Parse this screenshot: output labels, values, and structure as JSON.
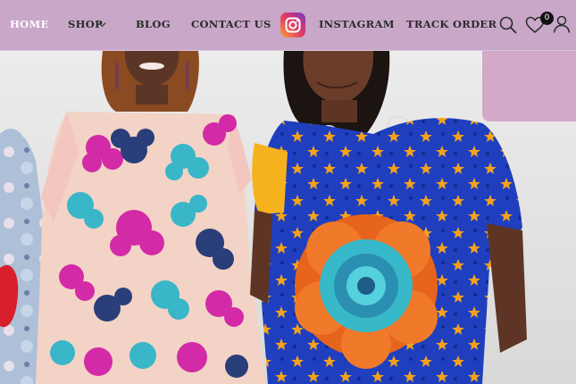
{
  "nav": {
    "home": "HOME",
    "shop": "SHOP",
    "blog": "BLOG",
    "contact": "CONTACT US",
    "instagram": "INSTAGRAM",
    "track_order": "TRACK ORDER"
  },
  "wishlist": {
    "count": "0"
  },
  "icons": {
    "shop_dropdown": "chevron-down-icon",
    "instagram": "instagram-icon",
    "search": "search-icon",
    "wishlist": "heart-icon",
    "account": "user-icon"
  },
  "colors": {
    "nav_background": "#c8a7c9",
    "active_link": "#ffffff",
    "link": "#2b2b2b",
    "badge": "#111111"
  }
}
